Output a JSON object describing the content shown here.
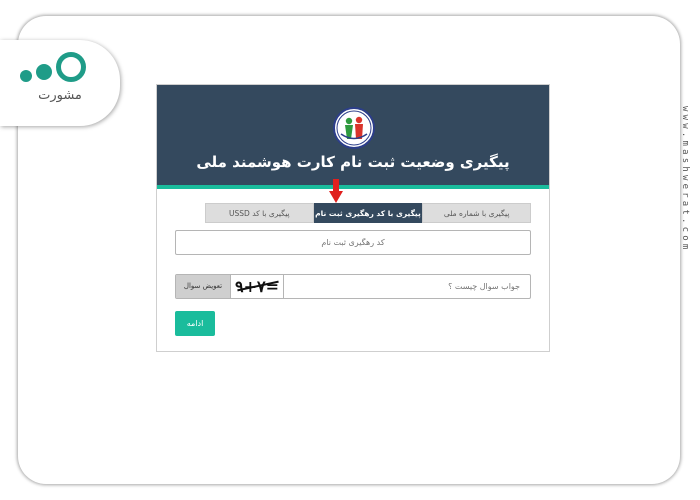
{
  "brand": {
    "logo_text": "مشورت",
    "url_vertical": "www.mashwerat.com",
    "accent_color": "#1f9c88"
  },
  "app": {
    "title": "پیگیری وضعیت ثبت نام کارت هوشمند ملی",
    "header_color": "#34495e",
    "accent_color": "#1abc9c",
    "tabs": [
      {
        "label": "پیگیری با شماره ملی",
        "active": false
      },
      {
        "label": "پیگیری با کد رهگیری ثبت نام",
        "active": true
      },
      {
        "label": "پیگیری با کد USSD",
        "active": false
      }
    ],
    "tracking_placeholder": "کد رهگیری ثبت نام",
    "captcha": {
      "answer_placeholder": "جواب سوال چیست ؟",
      "image_text": "۹+۷=",
      "refresh_label": "تعویض سوال"
    },
    "continue_label": "ادامه"
  },
  "icons": {
    "emblem": "national-emblem-icon",
    "arrow": "red-arrow-down-icon"
  }
}
